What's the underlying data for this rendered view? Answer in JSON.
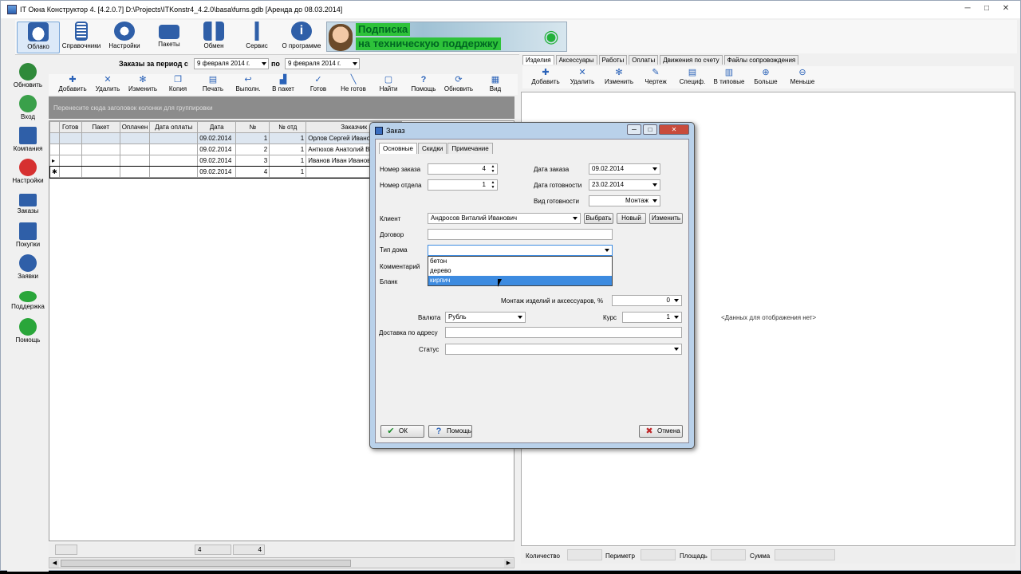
{
  "window": {
    "title": "IT Окна Конструктор 4. [4.2.0.7] D:\\Projects\\ITKonstr4_4.2.0\\basa\\furns.gdb [Аренда до 08.03.2014]",
    "min": "─",
    "max": "□",
    "close": "✕"
  },
  "topbar": {
    "items": [
      {
        "label": "Облако",
        "icon": "cloud-icon",
        "color": "#2f5fa8"
      },
      {
        "label": "Справочники",
        "icon": "book-icon",
        "color": "#2f5fa8"
      },
      {
        "label": "Настройки",
        "icon": "gear-icon",
        "color": "#2f5fa8"
      },
      {
        "label": "Пакеты",
        "icon": "suitcase-icon",
        "color": "#2f5fa8"
      },
      {
        "label": "Обмен",
        "icon": "exchange-icon",
        "color": "#2f5fa8"
      },
      {
        "label": "Сервис",
        "icon": "tool-icon",
        "color": "#2f5fa8"
      },
      {
        "label": "О программе",
        "icon": "info-icon",
        "color": "#2f5fa8"
      }
    ]
  },
  "banner": {
    "line1": "Подписка",
    "line2": "на техническую поддержку"
  },
  "leftnav": {
    "items": [
      {
        "label": "Обновить",
        "color": "#2f8a3a"
      },
      {
        "label": "Вход",
        "color": "#3aa04a"
      },
      {
        "label": "Компания",
        "color": "#2f5fa8"
      },
      {
        "label": "Настройки",
        "color": "#d63030"
      },
      {
        "label": "Заказы",
        "color": "#2f5fa8"
      },
      {
        "label": "Покупки",
        "color": "#2f5fa8"
      },
      {
        "label": "Заявки",
        "color": "#2f5fa8"
      },
      {
        "label": "Поддержка",
        "color": "#2aa63a"
      },
      {
        "label": "Помощь",
        "color": "#2aa63a"
      }
    ]
  },
  "orders": {
    "period_label": "Заказы за период с",
    "from": "9 февраля 2014 г.",
    "to_label": "по",
    "to": "9 февраля 2014 г.",
    "toolbar": [
      "Добавить",
      "Удалить",
      "Изменить",
      "Копия",
      "Печать",
      "Выполн.",
      "В пакет",
      "Готов",
      "Не готов",
      "Найти",
      "Помощь",
      "Обновить",
      "Вид"
    ],
    "group_hint": "Перенесите сюда заголовок колонки для группировки",
    "columns": [
      "Готов",
      "Пакет",
      "Оплачен",
      "Дата оплаты",
      "Дата",
      "№",
      "№ отд",
      "Заказчик"
    ],
    "rows": [
      {
        "mark": "",
        "date": "09.02.2014",
        "num": "1",
        "dep": "1",
        "customer": "Орлов Сергей Ивано"
      },
      {
        "mark": "",
        "date": "09.02.2014",
        "num": "2",
        "dep": "1",
        "customer": "Антюхов Анатолий В"
      },
      {
        "mark": "▸",
        "date": "09.02.2014",
        "num": "3",
        "dep": "1",
        "customer": "Иванов Иван Иванов"
      },
      {
        "mark": "✱",
        "date": "09.02.2014",
        "num": "4",
        "dep": "1",
        "customer": ""
      }
    ],
    "sum_date_count": "4",
    "sum_num_count": "4"
  },
  "right": {
    "tabs": [
      "Изделия",
      "Аксессуары",
      "Работы",
      "Оплаты",
      "Движения по счету",
      "Файлы сопровождения"
    ],
    "toolbar": [
      "Добавить",
      "Удалить",
      "Изменить",
      "Чертеж",
      "Специф.",
      "В типовые",
      "Больше",
      "Меньше"
    ],
    "no_data": "<Данных для отображения нет>",
    "footer": {
      "qty": "Количество",
      "perimeter": "Периметр",
      "area": "Площадь",
      "sum": "Сумма"
    }
  },
  "dialog": {
    "title": "Заказ",
    "tabs": [
      "Основные",
      "Скидки",
      "Примечание"
    ],
    "order_no_label": "Номер заказа",
    "order_no": "4",
    "dep_no_label": "Номер отдела",
    "dep_no": "1",
    "order_date_label": "Дата заказа",
    "order_date": "09.02.2014",
    "ready_date_label": "Дата готовности",
    "ready_date": "23.02.2014",
    "ready_type_label": "Вид готовности",
    "ready_type": "Монтаж",
    "client_label": "Клиент",
    "client": "Андросов Виталий Иванович",
    "btn_choose": "Выбрать",
    "btn_new": "Новый",
    "btn_edit": "Изменить",
    "contract_label": "Договор",
    "house_type_label": "Тип дома",
    "house_options": [
      "бетон",
      "дерево",
      "кирпич"
    ],
    "comment_label": "Комментарий",
    "blank_label": "Бланк",
    "mount_label": "Монтаж изделий и аксессуаров, %",
    "mount_value": "0",
    "currency_label": "Валюта",
    "currency": "Рубль",
    "rate_label": "Курс",
    "rate": "1",
    "delivery_label": "Доставка по адресу",
    "status_label": "Статус",
    "ok": "ОК",
    "help": "Помощь",
    "cancel": "Отмена"
  }
}
